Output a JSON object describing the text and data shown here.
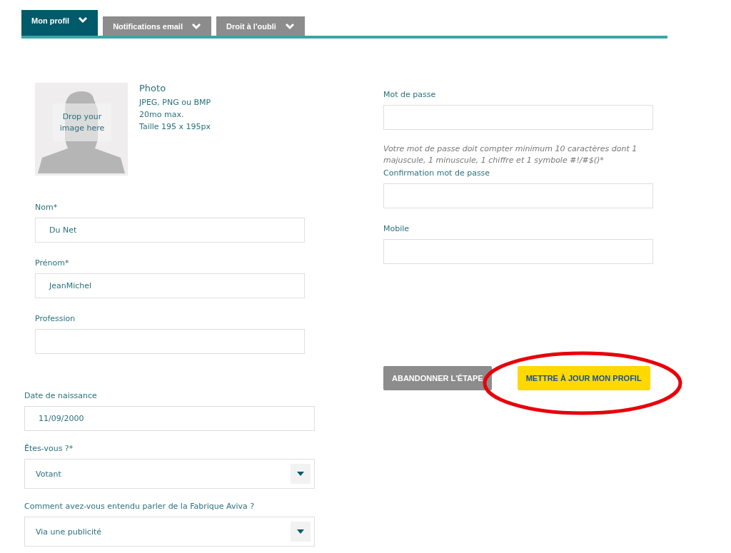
{
  "tabs": [
    {
      "label": "Mon profil",
      "selected": true
    },
    {
      "label": "Notifications email",
      "selected": false
    },
    {
      "label": "Droit à l'oubli",
      "selected": false
    }
  ],
  "photo": {
    "dropzone_text": "Drop your image here",
    "title": "Photo",
    "requirements": [
      "JPEG, PNG ou BMP",
      "20mo max.",
      "Taille 195 x 195px"
    ]
  },
  "identity_fields": [
    {
      "kind": "text",
      "label": "Nom*",
      "value": "Du Net"
    },
    {
      "kind": "text",
      "label": "Prénom*",
      "value": "JeanMichel"
    },
    {
      "kind": "text",
      "label": "Profession"
    }
  ],
  "extra_fields": [
    {
      "kind": "text",
      "label": "Date de naissance",
      "value": "11/09/2000"
    },
    {
      "kind": "select",
      "label": "Êtes-vous ?*",
      "value": "Votant"
    },
    {
      "kind": "select",
      "label": "Comment avez-vous entendu parler de la Fabrique Aviva ?",
      "value": "Via une publicité"
    }
  ],
  "account_fields": [
    {
      "kind": "text",
      "label": "Mot de passe",
      "hint": "Votre mot de passe doit compter minimum 10 caractères dont 1 majuscule, 1 minuscule, 1 chiffre et 1 symbole #!/#$()*"
    },
    {
      "kind": "text",
      "label": "Confirmation mot de passe"
    },
    {
      "kind": "text",
      "label": "Mobile"
    }
  ],
  "buttons": [
    {
      "label": "ABANDONNER L'ÉTAPE",
      "kind": "secondary"
    },
    {
      "label": "METTRE À JOUR MON PROFIL",
      "kind": "primary"
    }
  ]
}
